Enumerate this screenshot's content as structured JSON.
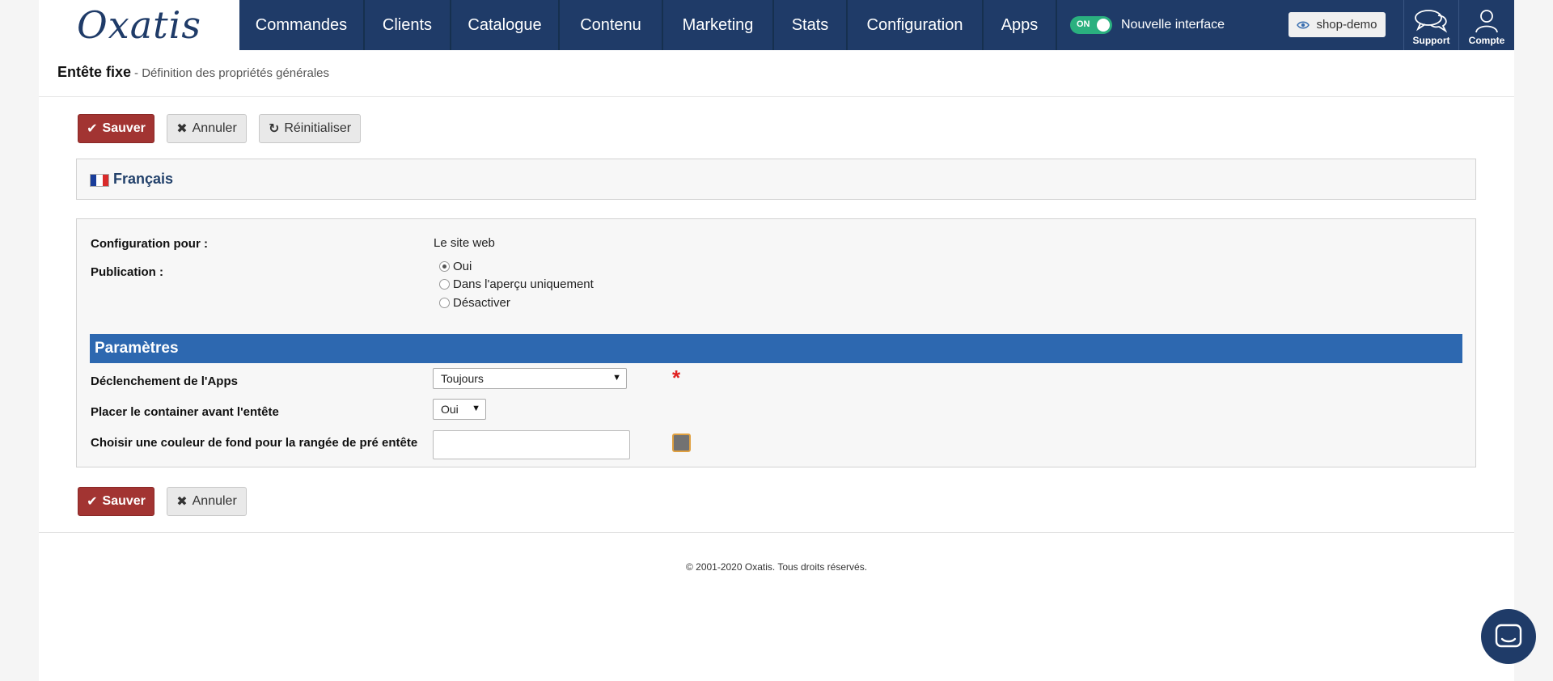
{
  "brand": {
    "logo": "Oxatis"
  },
  "nav": [
    {
      "label": "Commandes"
    },
    {
      "label": "Clients"
    },
    {
      "label": "Catalogue"
    },
    {
      "label": "Contenu"
    },
    {
      "label": "Marketing"
    },
    {
      "label": "Stats"
    },
    {
      "label": "Configuration"
    },
    {
      "label": "Apps"
    }
  ],
  "toggle": {
    "state": "ON",
    "label": "Nouvelle interface"
  },
  "shop": {
    "label": "shop-demo"
  },
  "top_icons": {
    "support": "Support",
    "account": "Compte"
  },
  "page": {
    "title": "Entête fixe",
    "subtitle": "- Définition des propriétés générales"
  },
  "actions": {
    "save": "Sauver",
    "cancel": "Annuler",
    "reset": "Réinitialiser"
  },
  "language": {
    "label": "Français"
  },
  "form": {
    "config_label": "Configuration pour :",
    "config_value": "Le site web",
    "publication_label": "Publication :",
    "publication_options": [
      "Oui",
      "Dans l'aperçu uniquement",
      "Désactiver"
    ],
    "publication_selected": "Oui",
    "section_title": "Paramètres",
    "trigger_label": "Déclenchement de l'Apps",
    "trigger_value": "Toujours",
    "required_mark": "*",
    "container_label": "Placer le container avant l'entête",
    "container_value": "Oui",
    "color_label": "Choisir une couleur de fond pour la rangée de pré entête",
    "color_value": "",
    "swatch_color": "#727272"
  },
  "footer": {
    "copyright": "© 2001-2020 Oxatis. Tous droits réservés."
  },
  "colors": {
    "topbar": "#1f3b68",
    "save": "#a23432",
    "section": "#2d68b0",
    "toggle_on": "#2ab07f",
    "required": "#e02020"
  }
}
